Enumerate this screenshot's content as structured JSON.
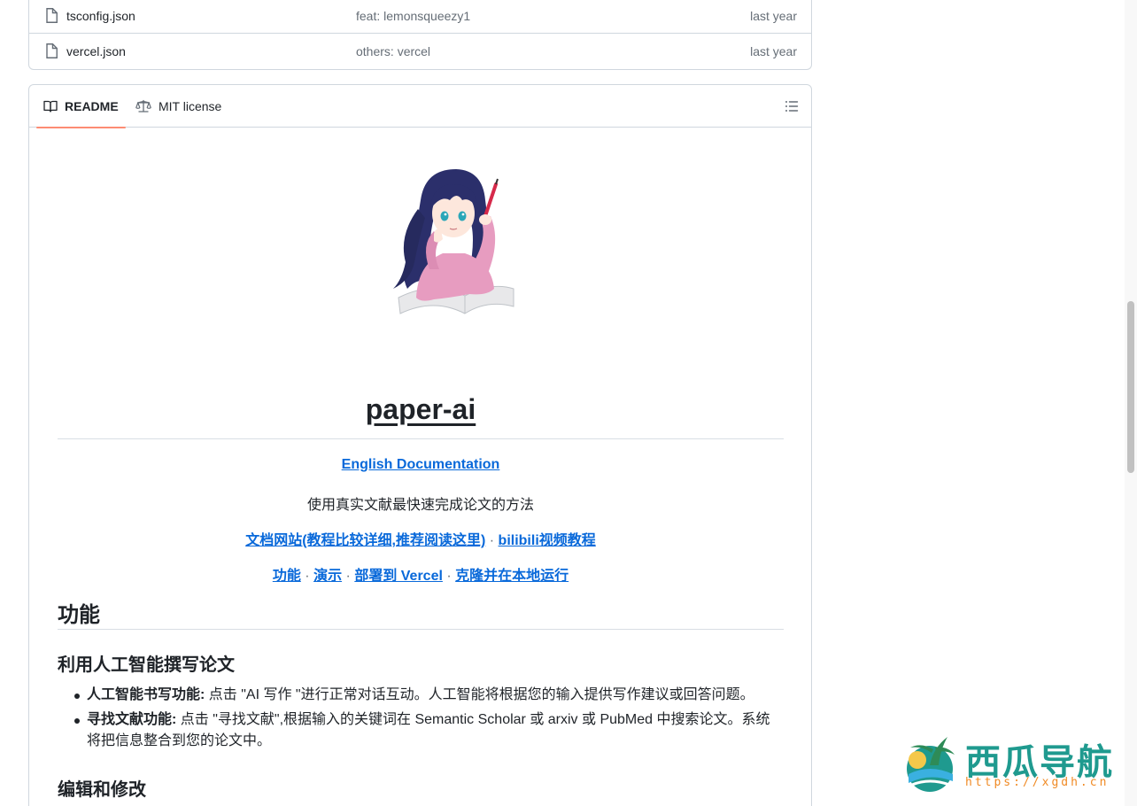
{
  "files": [
    {
      "name": "tsconfig.json",
      "commit": "feat: lemonsqueezy1",
      "time": "last year"
    },
    {
      "name": "vercel.json",
      "commit": "others: vercel",
      "time": "last year"
    }
  ],
  "readme_tabs": {
    "readme": "README",
    "license": "MIT license"
  },
  "readme": {
    "title": "paper-ai",
    "english_doc": "English Documentation",
    "tagline": "使用真实文献最快速完成论文的方法",
    "doc_site": "文档网站(教程比较详细,推荐阅读这里)",
    "bilibili": "bilibili视频教程",
    "nav": {
      "features": "功能",
      "demo": "演示",
      "deploy": "部署到 Vercel",
      "clone": "克隆并在本地运行"
    },
    "separator": "·",
    "h2_features": "功能",
    "h3_ai_writing": "利用人工智能撰写论文",
    "bullets": [
      {
        "bold": "人工智能书写功能:",
        "text": " 点击 \"AI 写作 \"进行正常对话互动。人工智能将根据您的输入提供写作建议或回答问题。"
      },
      {
        "bold": "寻找文献功能:",
        "text": " 点击 \"寻找文献\",根据输入的关键词在 Semantic Scholar 或 arxiv 或 PubMed 中搜索论文。系统将把信息整合到您的论文中。"
      }
    ],
    "h3_edit": "编辑和修改"
  },
  "watermark": {
    "brand": "西瓜导航",
    "url": "https://xgdh.cn"
  },
  "colors": {
    "link": "#0969da",
    "tab_underline": "#fd8c73",
    "border": "#d0d7de"
  }
}
